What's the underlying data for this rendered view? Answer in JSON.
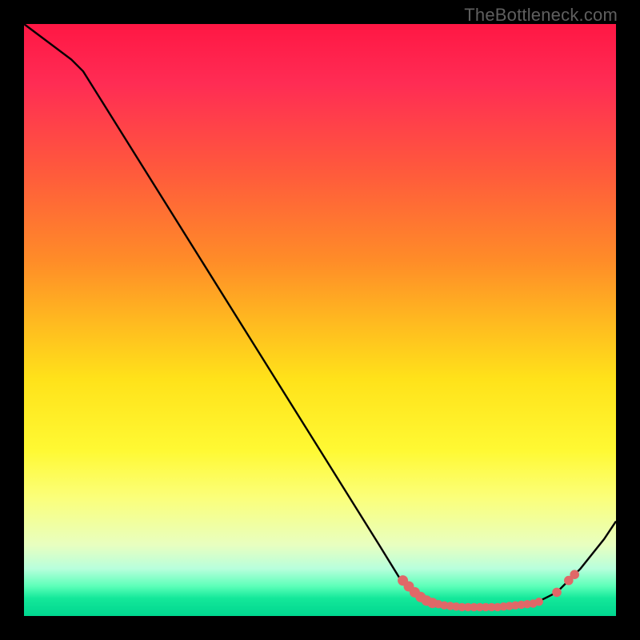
{
  "attribution": "TheBottleneck.com",
  "chart_data": {
    "type": "line",
    "title": "",
    "xlabel": "",
    "ylabel": "",
    "xlim": [
      0,
      100
    ],
    "ylim": [
      0,
      100
    ],
    "curve": {
      "name": "main-curve",
      "points": [
        {
          "x": 0,
          "y": 100
        },
        {
          "x": 8,
          "y": 94
        },
        {
          "x": 10,
          "y": 92
        },
        {
          "x": 20,
          "y": 76
        },
        {
          "x": 30,
          "y": 60
        },
        {
          "x": 40,
          "y": 44
        },
        {
          "x": 50,
          "y": 28
        },
        {
          "x": 60,
          "y": 12
        },
        {
          "x": 64,
          "y": 5.5
        },
        {
          "x": 67,
          "y": 3
        },
        {
          "x": 70,
          "y": 2
        },
        {
          "x": 74,
          "y": 1.5
        },
        {
          "x": 80,
          "y": 1.5
        },
        {
          "x": 86,
          "y": 2
        },
        {
          "x": 90,
          "y": 4
        },
        {
          "x": 94,
          "y": 8
        },
        {
          "x": 98,
          "y": 13
        },
        {
          "x": 100,
          "y": 16
        }
      ]
    },
    "markers": {
      "name": "highlight-band",
      "color": "#e06868",
      "points": [
        {
          "x": 64,
          "y": 6
        },
        {
          "x": 65,
          "y": 5
        },
        {
          "x": 66,
          "y": 4
        },
        {
          "x": 67,
          "y": 3.2
        },
        {
          "x": 68,
          "y": 2.6
        },
        {
          "x": 69,
          "y": 2.2
        },
        {
          "x": 70,
          "y": 2.0
        },
        {
          "x": 71,
          "y": 1.8
        },
        {
          "x": 72,
          "y": 1.7
        },
        {
          "x": 73,
          "y": 1.6
        },
        {
          "x": 74,
          "y": 1.5
        },
        {
          "x": 75,
          "y": 1.5
        },
        {
          "x": 76,
          "y": 1.5
        },
        {
          "x": 77,
          "y": 1.5
        },
        {
          "x": 78,
          "y": 1.5
        },
        {
          "x": 79,
          "y": 1.5
        },
        {
          "x": 80,
          "y": 1.5
        },
        {
          "x": 81,
          "y": 1.6
        },
        {
          "x": 82,
          "y": 1.7
        },
        {
          "x": 83,
          "y": 1.8
        },
        {
          "x": 84,
          "y": 1.9
        },
        {
          "x": 85,
          "y": 2.0
        },
        {
          "x": 86,
          "y": 2.1
        },
        {
          "x": 87,
          "y": 2.4
        },
        {
          "x": 90,
          "y": 4.0
        },
        {
          "x": 92,
          "y": 6.0
        },
        {
          "x": 93,
          "y": 7.0
        }
      ]
    },
    "gradient_stops": [
      {
        "pos": 0,
        "color": "#ff1744"
      },
      {
        "pos": 50,
        "color": "#ffe21a"
      },
      {
        "pos": 100,
        "color": "#00d68f"
      }
    ]
  }
}
